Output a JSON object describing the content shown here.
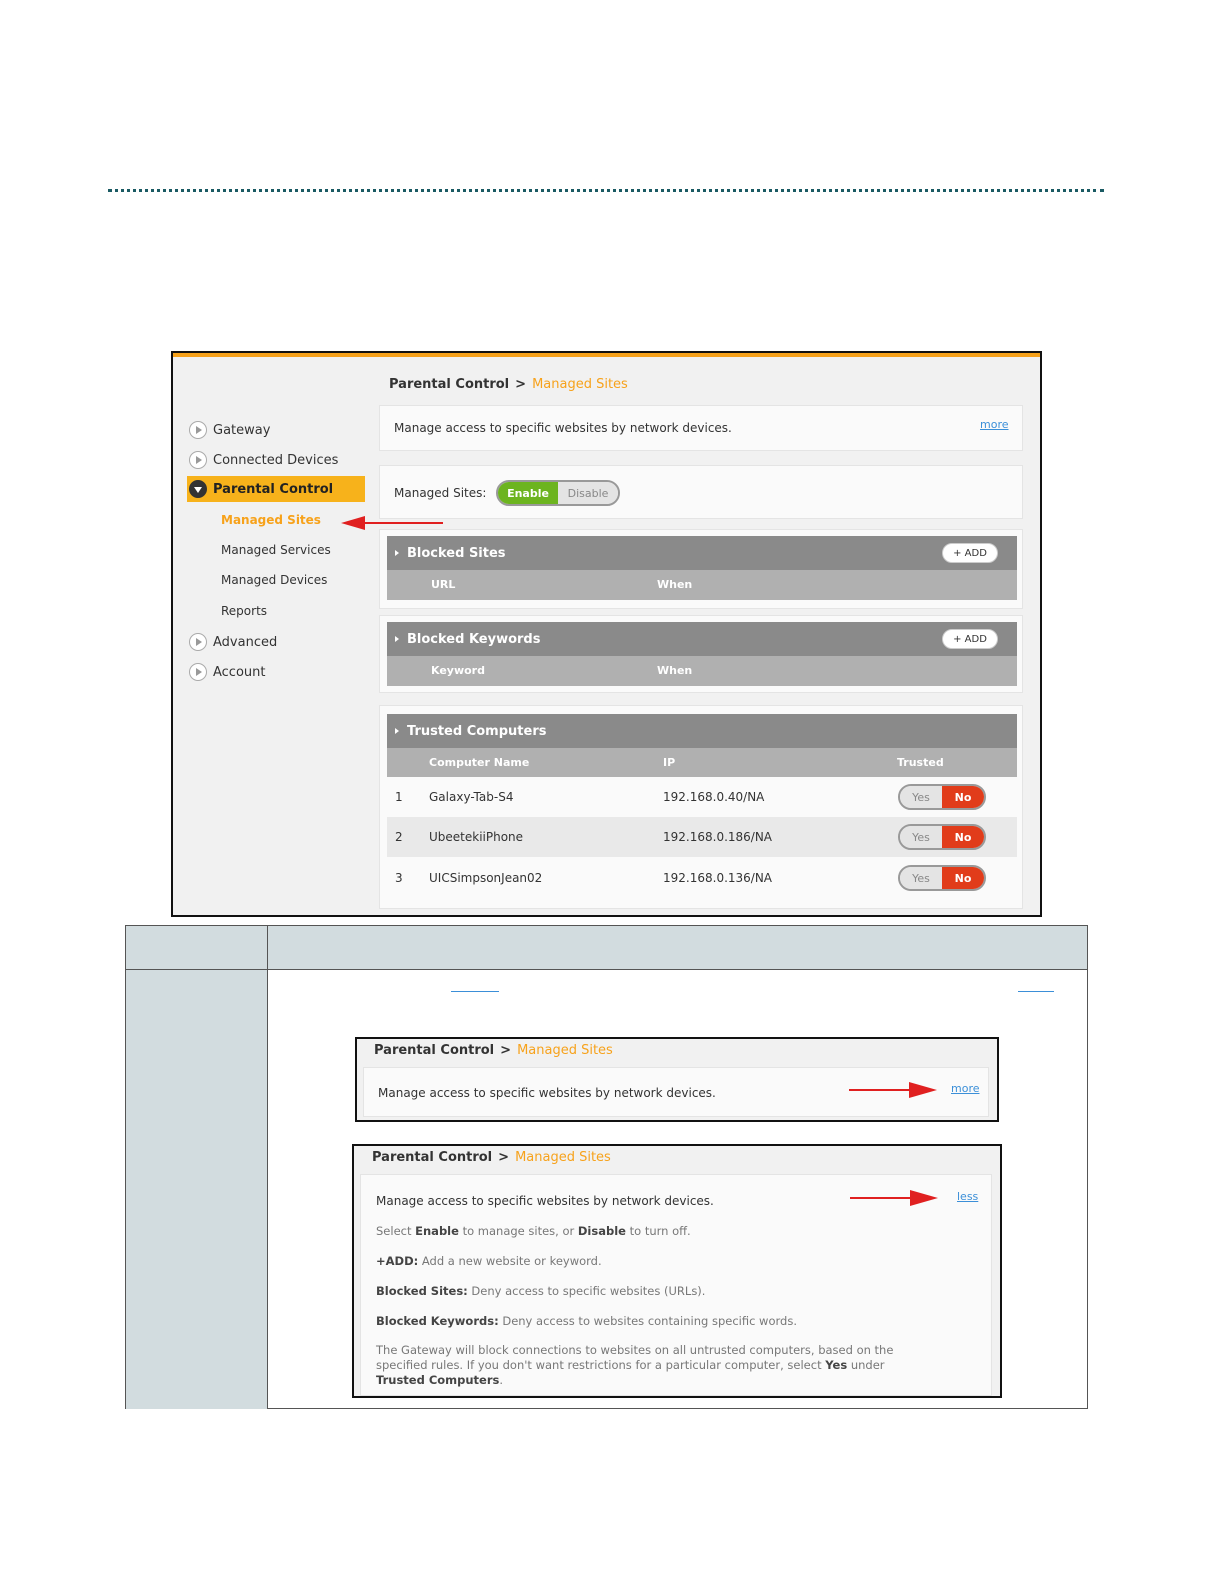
{
  "breadcrumb": {
    "section": "Parental Control",
    "separator": ">",
    "current": "Managed Sites"
  },
  "sidebar": {
    "items": [
      {
        "label": "Gateway"
      },
      {
        "label": "Connected Devices"
      },
      {
        "label": "Parental Control"
      },
      {
        "label": "Advanced"
      },
      {
        "label": "Account"
      }
    ],
    "sub_items": [
      {
        "label": "Managed Sites"
      },
      {
        "label": "Managed Services"
      },
      {
        "label": "Managed Devices"
      },
      {
        "label": "Reports"
      }
    ]
  },
  "intro": {
    "text": "Manage access to specific websites by network devices.",
    "more_label": "more"
  },
  "managed_sites": {
    "label": "Managed Sites:",
    "enable": "Enable",
    "disable": "Disable"
  },
  "blocked_sites": {
    "title": "Blocked Sites",
    "add": "+ ADD",
    "col_url": "URL",
    "col_when": "When"
  },
  "blocked_keywords": {
    "title": "Blocked Keywords",
    "add": "+ ADD",
    "col_keyword": "Keyword",
    "col_when": "When"
  },
  "trusted_computers": {
    "title": "Trusted Computers",
    "col_name": "Computer Name",
    "col_ip": "IP",
    "col_trusted": "Trusted",
    "rows": [
      {
        "num": "1",
        "name": "Galaxy-Tab-S4",
        "ip": "192.168.0.40/NA",
        "yes": "Yes",
        "no": "No"
      },
      {
        "num": "2",
        "name": "UbeetekiiPhone",
        "ip": "192.168.0.186/NA",
        "yes": "Yes",
        "no": "No"
      },
      {
        "num": "3",
        "name": "UICSimpsonJean02",
        "ip": "192.168.0.136/NA",
        "yes": "Yes",
        "no": "No"
      }
    ]
  },
  "help_expanded": {
    "less_label": "less",
    "line1_pre": "Select ",
    "line1_b1": "Enable",
    "line1_mid": " to manage sites, or ",
    "line1_b2": "Disable",
    "line1_post": " to turn off.",
    "line2_b": "+ADD:",
    "line2_text": " Add a new website or keyword.",
    "line3_b": "Blocked Sites:",
    "line3_text": " Deny access to specific websites (URLs).",
    "line4_b": "Blocked Keywords:",
    "line4_text": " Deny access to websites containing specific words.",
    "line5_a": "The Gateway will block connections to websites on all untrusted computers, based on the",
    "line5_b": "specified rules. If you don't want restrictions for a particular computer, select ",
    "line5_b_bold": "Yes",
    "line5_b_post": " under",
    "line5_c_bold": "Trusted Computers",
    "line5_c_post": "."
  },
  "colors": {
    "accent": "#f7a21b",
    "enable_green": "#6cb41f",
    "no_red": "#e13c1a",
    "link_blue": "#3b8fd8",
    "table_header": "#d2dcdf"
  }
}
